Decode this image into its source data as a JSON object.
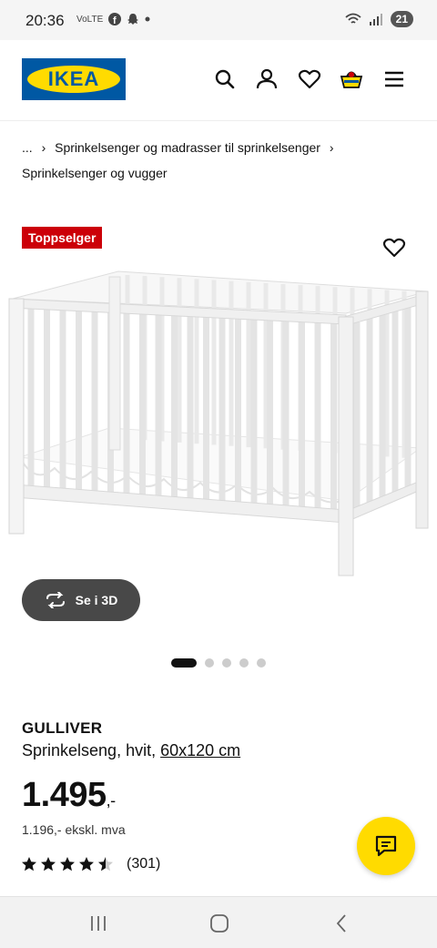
{
  "status_bar": {
    "time": "20:36",
    "notif_icons": [
      "volte-icon",
      "facebook-icon",
      "snapchat-icon",
      "dot-icon"
    ],
    "battery": "21"
  },
  "header": {
    "logo_text": "IKEA",
    "brand_colors": {
      "blue": "#0058a3",
      "yellow": "#ffdb00"
    }
  },
  "breadcrumb": {
    "ellipsis": "...",
    "sep": "›",
    "level1": "Sprinkelsenger og madrasser til sprinkelsenger",
    "level2": "Sprinkelsenger og vugger"
  },
  "badge": {
    "label": "Toppselger",
    "color": "#cc0008"
  },
  "view3d": {
    "label": "Se i 3D"
  },
  "carousel": {
    "count": 5,
    "active": 1
  },
  "product": {
    "name": "GULLIVER",
    "description": "Sprinkelseng, hvit,",
    "size_link": "60x120 cm",
    "price": "1.495",
    "price_suffix": ",-",
    "price_ex_vat": "1.196,- ekskl. mva",
    "rating": 4.5,
    "rating_count": "(301)"
  }
}
